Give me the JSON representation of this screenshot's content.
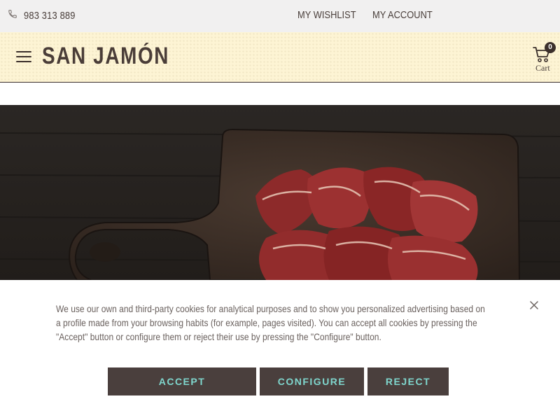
{
  "topbar": {
    "phone_icon": "phone-icon",
    "phone": "983 313 889",
    "wishlist_label": "MY WISHLIST",
    "account_label": "MY ACCOUNT"
  },
  "header": {
    "menu_icon": "hamburger-menu-icon",
    "logo_text": "SAN JAMÓN",
    "cart_icon": "shopping-cart-icon",
    "cart_count": "0",
    "cart_label": "Cart"
  },
  "hero": {
    "image": "sliced jamón on dark wooden cutting board"
  },
  "cookie": {
    "text": "We use our own and third-party cookies for analytical purposes and to show you personalized advertising based on a profile made from your browsing habits (for example, pages visited). You can accept all cookies by pressing the \"Accept\" button or configure them or reject their use by pressing the \"Configure\" button.",
    "close_icon": "close-icon",
    "accept_label": "ACCEPT",
    "configure_label": "CONFIGURE",
    "reject_label": "REJECT"
  },
  "colors": {
    "topbar_bg": "#f1f0f0",
    "header_bg": "#fdf4d4",
    "brand_dark": "#4a3d38",
    "button_bg": "#4a3f3d",
    "button_text": "#7fd6cd"
  }
}
